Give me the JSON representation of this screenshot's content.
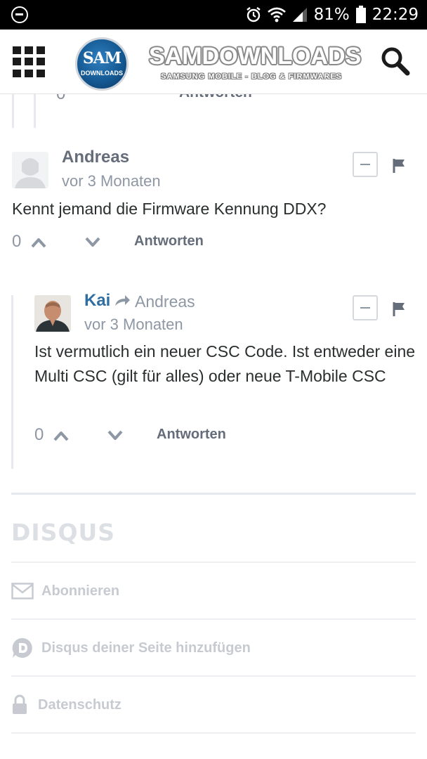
{
  "status_bar": {
    "battery_percent": "81%",
    "time": "22:29"
  },
  "app_bar": {
    "logo_badge_line1": "SAM",
    "logo_badge_line2": "DOWNLOADS",
    "logo_title": "SAMDOWNLOADS",
    "logo_subtitle": "SAMSUNG MOBILE - BLOG & FIRMWARES"
  },
  "previous_comment_footer": {
    "votes": "0",
    "reply_label": "Antworten"
  },
  "comments": [
    {
      "author": "Andreas",
      "time": "vor 3 Monaten",
      "text": "Kennt jemand die Firmware Kennung DDX?",
      "votes": "0",
      "reply_label": "Antworten"
    },
    {
      "author": "Kai",
      "reply_to": "Andreas",
      "time": "vor 3 Monaten",
      "text": "Ist vermutlich ein neuer CSC Code. Ist entweder eine Multi CSC (gilt für alles) oder neue T-Mobile CSC",
      "votes": "0",
      "reply_label": "Antworten"
    }
  ],
  "footer": {
    "brand": "DISQUS",
    "subscribe": "Abonnieren",
    "add_disqus": "Disqus deiner Seite hinzufügen",
    "privacy": "Datenschutz"
  }
}
